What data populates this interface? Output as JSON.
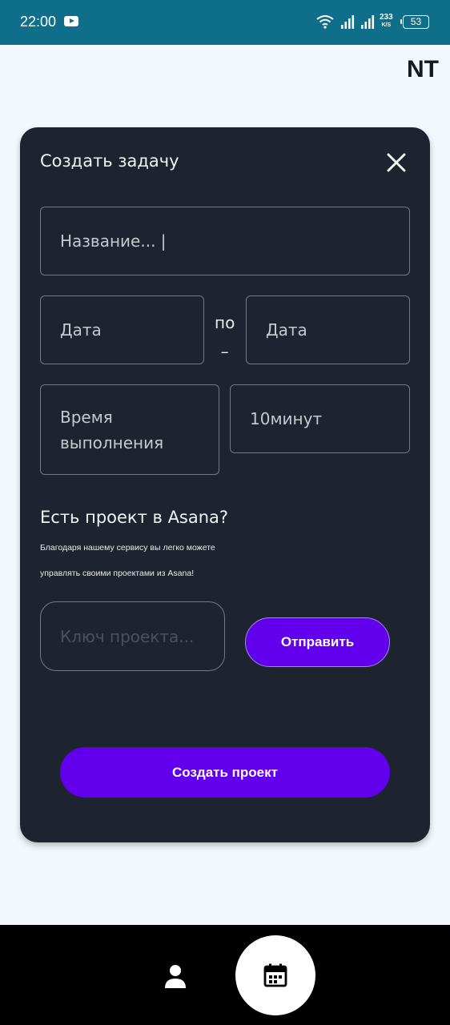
{
  "status_bar": {
    "time": "22:00",
    "net_speed_value": "233",
    "net_speed_unit": "K/S",
    "battery": "53",
    "icons": [
      "youtube-icon",
      "wifi-icon",
      "signal-icon",
      "signal-icon",
      "battery-icon"
    ]
  },
  "header": {
    "logo": "NT"
  },
  "dialog": {
    "title": "Создать задачу",
    "close_icon": "close-icon",
    "name_field": "Название... |",
    "date_start": "Дата",
    "date_separator_top": "по",
    "date_separator_bottom": "–",
    "date_end": "Дата",
    "time_field": "Время выполнения",
    "minutes_field": "10минут",
    "asana_title": "Есть проект в Asana?",
    "asana_desc_1": "Благодаря нашему сервису вы легко можете",
    "asana_desc_2": "управлять своими проектами из Asana!",
    "project_key_placeholder": "Ключ проекта...",
    "send_label": "Отправить",
    "create_label": "Создать проект"
  },
  "bottom_nav": {
    "profile_icon": "person-icon",
    "calendar_icon": "calendar-icon"
  },
  "colors": {
    "status_bar": "#0f6f8b",
    "card": "#1d2430",
    "accent": "#6200ee",
    "page_bg": "#f2f8fe"
  }
}
